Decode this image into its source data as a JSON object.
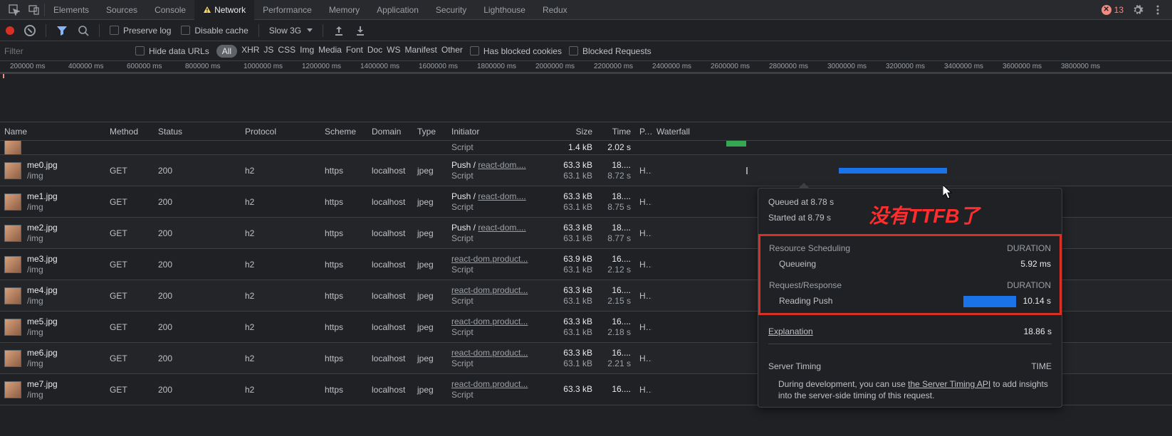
{
  "tabs": {
    "list": [
      "Elements",
      "Sources",
      "Console",
      "Network",
      "Performance",
      "Memory",
      "Application",
      "Security",
      "Lighthouse",
      "Redux"
    ],
    "active": "Network"
  },
  "errors": {
    "count": "13"
  },
  "toolbar": {
    "preserve": "Preserve log",
    "disable": "Disable cache",
    "throttle": "Slow 3G"
  },
  "filter": {
    "placeholder": "Filter",
    "hide": "Hide data URLs",
    "types": [
      "All",
      "XHR",
      "JS",
      "CSS",
      "Img",
      "Media",
      "Font",
      "Doc",
      "WS",
      "Manifest",
      "Other"
    ],
    "active": "All",
    "blockedCookies": "Has blocked cookies",
    "blockedReq": "Blocked Requests"
  },
  "timeline": {
    "ticks": [
      "200000 ms",
      "400000 ms",
      "600000 ms",
      "800000 ms",
      "1000000 ms",
      "1200000 ms",
      "1400000 ms",
      "1600000 ms",
      "1800000 ms",
      "2000000 ms",
      "2200000 ms",
      "2400000 ms",
      "2600000 ms",
      "2800000 ms",
      "3000000 ms",
      "3200000 ms",
      "3400000 ms",
      "3600000 ms",
      "3800000 ms"
    ]
  },
  "columns": {
    "name": "Name",
    "method": "Method",
    "status": "Status",
    "protocol": "Protocol",
    "scheme": "Scheme",
    "domain": "Domain",
    "type": "Type",
    "initiator": "Initiator",
    "size": "Size",
    "time": "Time",
    "priority": "P...",
    "waterfall": "Waterfall"
  },
  "rows": [
    {
      "name": "",
      "path": "",
      "method": "",
      "status": "",
      "protocol": "",
      "scheme": "",
      "domain": "",
      "type": "",
      "initL1": "",
      "initL2": "Script",
      "initLink": "",
      "size1": "1.4 kB",
      "size2": "",
      "time1": "2.02 s",
      "time2": "",
      "pri": "",
      "wfStart": 104,
      "wfLen": 28,
      "wfColor": "#34a853",
      "barTop": 0,
      "preShow": false,
      "half": true
    },
    {
      "name": "me0.jpg",
      "path": "/img",
      "method": "GET",
      "status": "200",
      "protocol": "h2",
      "scheme": "https",
      "domain": "localhost",
      "type": "jpeg",
      "initL1": "Push / ",
      "initLink": "react-dom....",
      "initL2": "Script",
      "size1": "63.3 kB",
      "size2": "63.1 kB",
      "time1": "18....",
      "time2": "8.72 s",
      "pri": "H...",
      "wfStart": 132,
      "wfLen": 0,
      "preShow": true,
      "bigStart": 262,
      "bigLen": 152
    },
    {
      "name": "me1.jpg",
      "path": "/img",
      "method": "GET",
      "status": "200",
      "protocol": "h2",
      "scheme": "https",
      "domain": "localhost",
      "type": "jpeg",
      "initL1": "Push / ",
      "initLink": "react-dom....",
      "initL2": "Script",
      "size1": "63.3 kB",
      "size2": "63.1 kB",
      "time1": "18....",
      "time2": "8.75 s",
      "pri": "H..."
    },
    {
      "name": "me2.jpg",
      "path": "/img",
      "method": "GET",
      "status": "200",
      "protocol": "h2",
      "scheme": "https",
      "domain": "localhost",
      "type": "jpeg",
      "initL1": "Push / ",
      "initLink": "react-dom....",
      "initL2": "Script",
      "size1": "63.3 kB",
      "size2": "63.1 kB",
      "time1": "18....",
      "time2": "8.77 s",
      "pri": "H..."
    },
    {
      "name": "me3.jpg",
      "path": "/img",
      "method": "GET",
      "status": "200",
      "protocol": "h2",
      "scheme": "https",
      "domain": "localhost",
      "type": "jpeg",
      "initL1": "",
      "initLink": "react-dom.product...",
      "initL2": "Script",
      "size1": "63.9 kB",
      "size2": "63.1 kB",
      "time1": "16....",
      "time2": "2.12 s",
      "pri": "H..."
    },
    {
      "name": "me4.jpg",
      "path": "/img",
      "method": "GET",
      "status": "200",
      "protocol": "h2",
      "scheme": "https",
      "domain": "localhost",
      "type": "jpeg",
      "initL1": "",
      "initLink": "react-dom.product...",
      "initL2": "Script",
      "size1": "63.3 kB",
      "size2": "63.1 kB",
      "time1": "16....",
      "time2": "2.15 s",
      "pri": "H..."
    },
    {
      "name": "me5.jpg",
      "path": "/img",
      "method": "GET",
      "status": "200",
      "protocol": "h2",
      "scheme": "https",
      "domain": "localhost",
      "type": "jpeg",
      "initL1": "",
      "initLink": "react-dom.product...",
      "initL2": "Script",
      "size1": "63.3 kB",
      "size2": "63.1 kB",
      "time1": "16....",
      "time2": "2.18 s",
      "pri": "H..."
    },
    {
      "name": "me6.jpg",
      "path": "/img",
      "method": "GET",
      "status": "200",
      "protocol": "h2",
      "scheme": "https",
      "domain": "localhost",
      "type": "jpeg",
      "initL1": "",
      "initLink": "react-dom.product...",
      "initL2": "Script",
      "size1": "63.3 kB",
      "size2": "63.1 kB",
      "time1": "16....",
      "time2": "2.21 s",
      "pri": "H..."
    },
    {
      "name": "me7.jpg",
      "path": "/img",
      "method": "GET",
      "status": "200",
      "protocol": "h2",
      "scheme": "https",
      "domain": "localhost",
      "type": "jpeg",
      "initL1": "",
      "initLink": "react-dom.product...",
      "initL2": "Script",
      "size1": "63.3 kB",
      "size2": "",
      "time1": "16....",
      "time2": "",
      "pri": "H..."
    }
  ],
  "tooltip": {
    "queued": "Queued at 8.78 s",
    "started": "Started at 8.79 s",
    "sec1": "Resource Scheduling",
    "dur": "DURATION",
    "q": "Queueing",
    "qv": "5.92 ms",
    "sec2": "Request/Response",
    "rp": "Reading Push",
    "rpv": "10.14 s",
    "exp": "Explanation",
    "total": "18.86 s",
    "st": "Server Timing",
    "time": "TIME",
    "desc1": "During development, you can use ",
    "descLink": "the Server Timing API",
    "desc2": " to add insights into the server-side timing of this request."
  },
  "annotation": "没有TTFB了"
}
